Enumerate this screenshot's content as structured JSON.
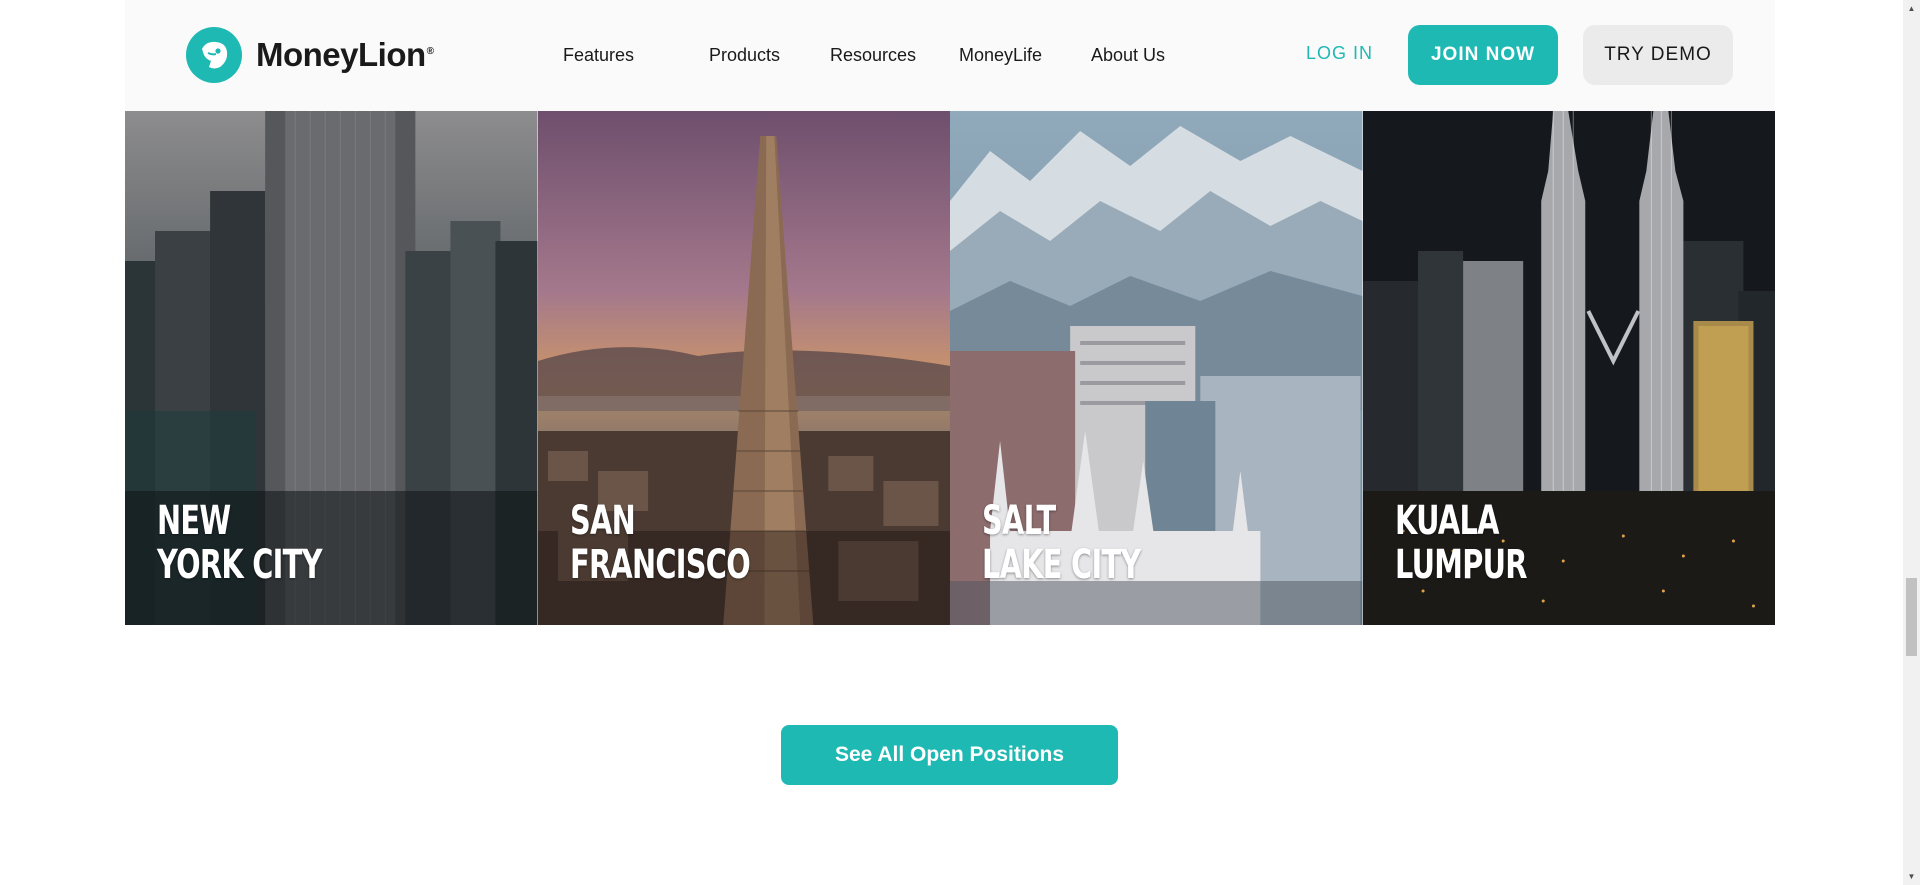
{
  "header": {
    "brand": "MoneyLion",
    "brand_mark": "®",
    "nav": [
      "Features",
      "Products",
      "Resources",
      "MoneyLife",
      "About Us"
    ],
    "login": "LOG IN",
    "join": "JOIN NOW",
    "demo": "TRY DEMO"
  },
  "cities": [
    {
      "line1": "NEW",
      "line2": "YORK CITY"
    },
    {
      "line1": "SAN",
      "line2": "FRANCISCO"
    },
    {
      "line1": "SALT",
      "line2": "LAKE CITY"
    },
    {
      "line1": "KUALA",
      "line2": "LUMPUR"
    }
  ],
  "cta": {
    "label": "See All Open Positions"
  },
  "colors": {
    "accent": "#1fb9b4",
    "text": "#1a1a1a",
    "header_bg": "#fafafa",
    "demo_bg": "#ebebeb"
  },
  "icons": {
    "logo": "lion-head-icon",
    "scroll_up": "arrow-up-icon",
    "scroll_down": "arrow-down-icon"
  }
}
